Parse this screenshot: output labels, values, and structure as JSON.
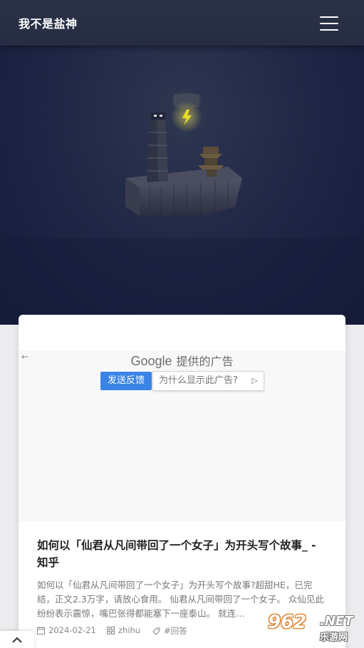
{
  "header": {
    "site_title": "我不是盐神",
    "menu_icon": "hamburger-menu-icon"
  },
  "ad": {
    "back_icon": "arrow-left-icon",
    "back_glyph": "←",
    "brand": "Google",
    "provided_text": "提供的广告",
    "feedback_label": "发送反馈",
    "why_label": "为什么显示此广告?",
    "why_icon_glyph": "▷"
  },
  "post": {
    "title": "如何以「仙君从凡间带回了一个女子」为开头写个故事_ - 知乎",
    "excerpt": "如何以「仙君从凡间带回了一个女子」为开头写个故事?超甜HE，已完结，正文2.3万字，请放心食用。 仙君从凡间带回了一个女子。 众仙见此纷纷表示震惊，嘴巴张得都能塞下一座泰山。 就连…",
    "date": "2024-02-21",
    "source": "zhihu",
    "tag": "#回答"
  },
  "watermark": {
    "num": "962",
    "net": ".NET",
    "cn": "乐游网"
  },
  "colors": {
    "header_bg": "#2b3146",
    "hero_bg": "#1d2342",
    "ad_button": "#3a84e6",
    "lightning": "#e8e02a"
  }
}
